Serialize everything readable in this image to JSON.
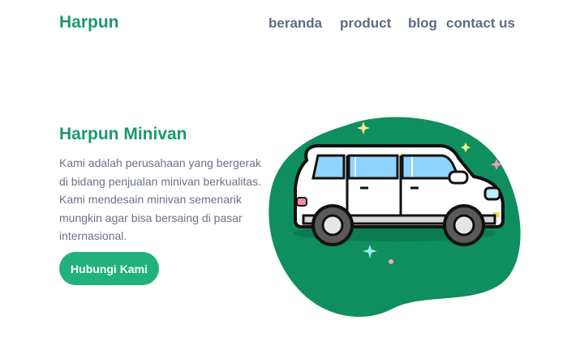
{
  "header": {
    "brand": "Harpun",
    "nav": [
      {
        "label": "beranda"
      },
      {
        "label": "product"
      },
      {
        "label": "blog"
      },
      {
        "label": "contact us"
      }
    ]
  },
  "hero": {
    "title": "Harpun Minivan",
    "description_lines": [
      "Kami adalah perusahaan yang bergerak",
      "di bidang penjualan minivan berkualitas.",
      "Kami mendesain minivan semenarik",
      "mungkin agar bisa bersaing di pasar",
      "internasional."
    ],
    "cta_label": "Hubungi Kami"
  },
  "illustration": {
    "icon": "minivan-icon",
    "blob_color": "#0f8e5f",
    "car_body_color": "#ffffff",
    "window_color": "#8fd3ff",
    "wheel_color": "#5a5a5a"
  },
  "colors": {
    "brand": "#1a9a6c",
    "nav_text": "#5f6b82",
    "body_text": "#6b7385",
    "button": "#20b27a"
  }
}
